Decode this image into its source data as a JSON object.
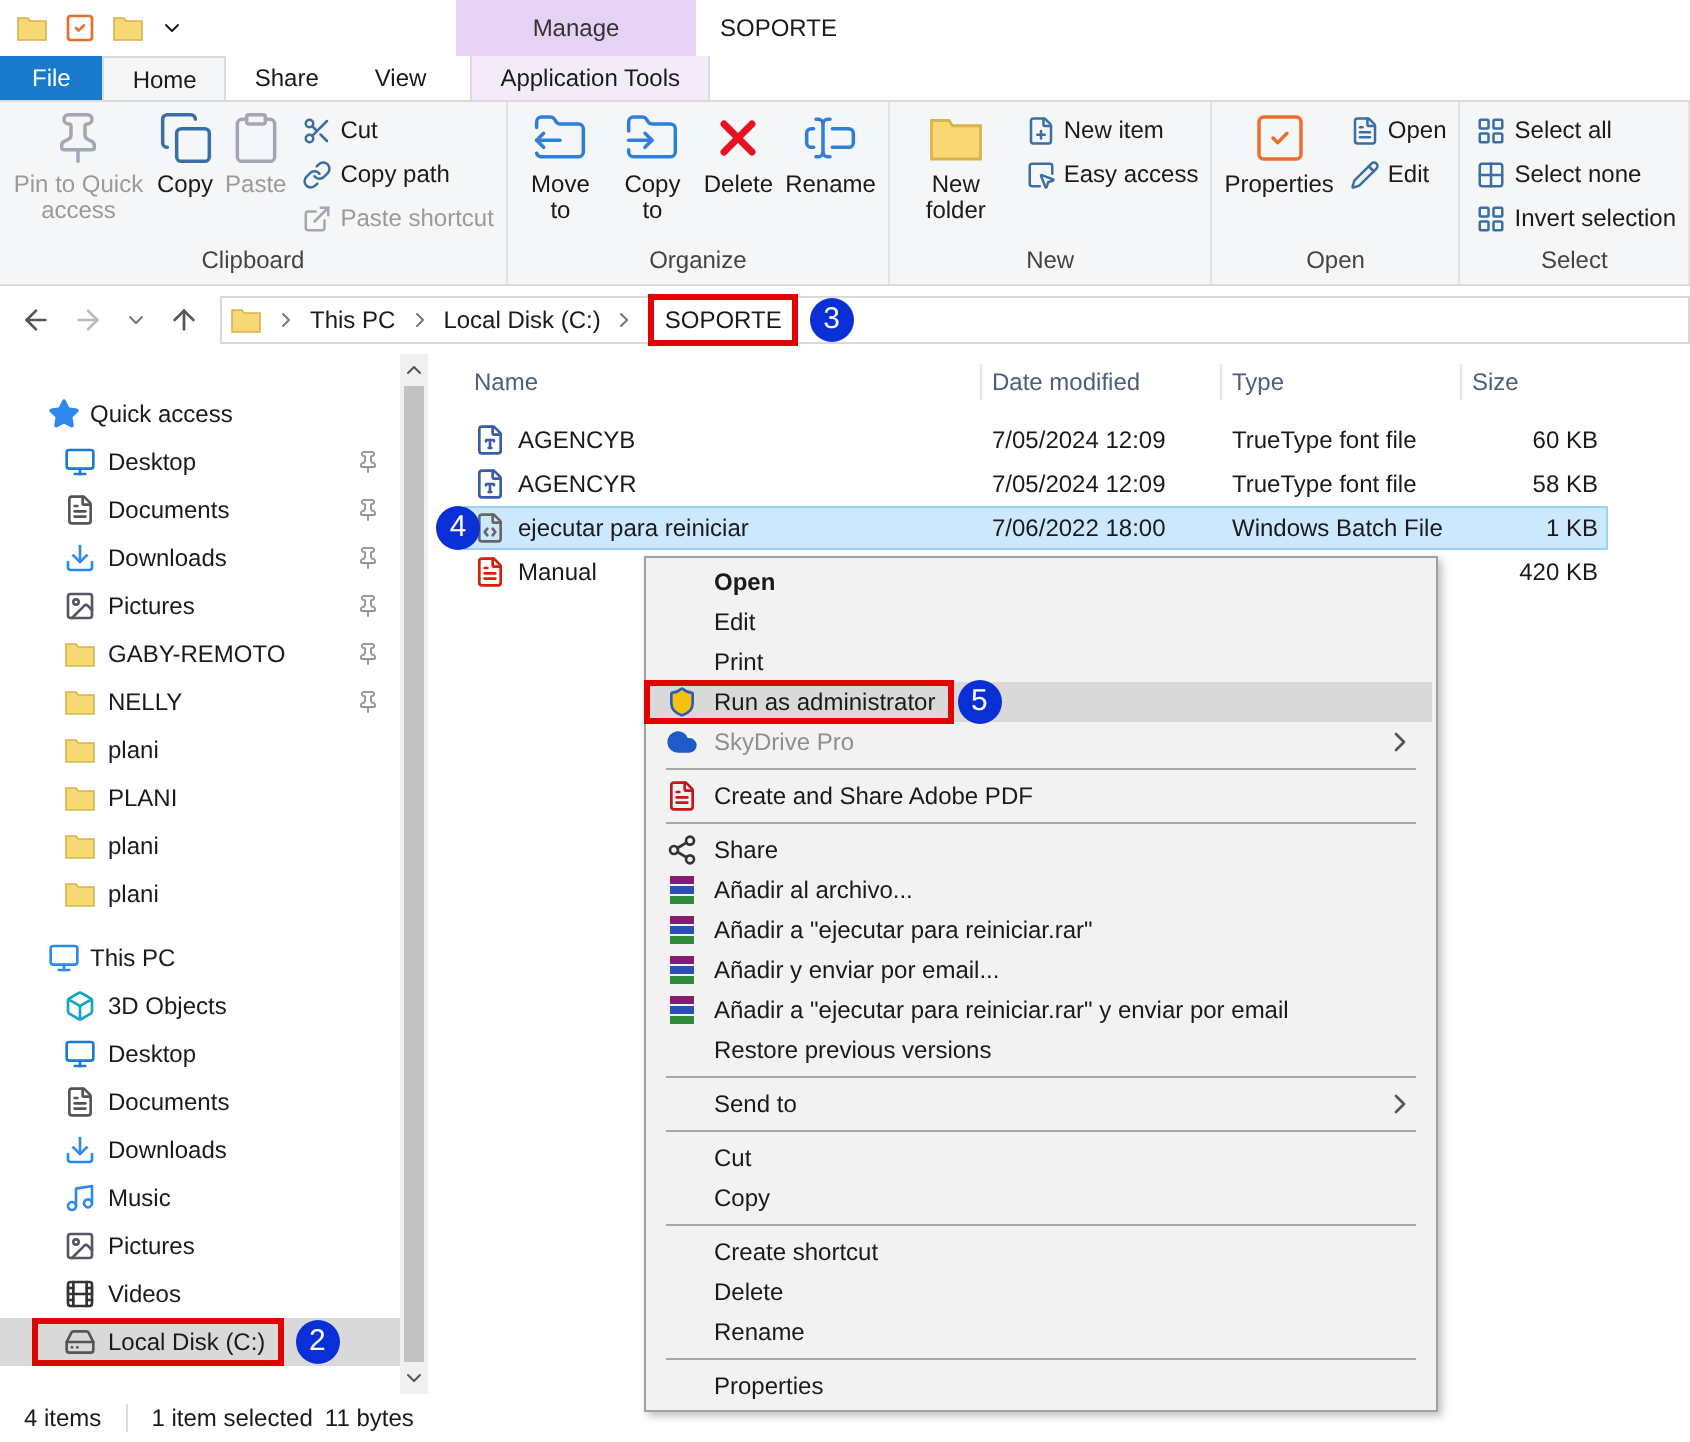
{
  "title_bar": {
    "context_tab": "Manage",
    "title": "SOPORTE"
  },
  "ribbon_tabs": [
    {
      "label": "File",
      "kind": "file",
      "selected": false
    },
    {
      "label": "Home",
      "kind": "tab",
      "selected": true
    },
    {
      "label": "Share",
      "kind": "tab",
      "selected": false
    },
    {
      "label": "View",
      "kind": "tab",
      "selected": false
    },
    {
      "label": "Application Tools",
      "kind": "context",
      "selected": false
    }
  ],
  "ribbon_groups": [
    {
      "label": "Clipboard",
      "buttons": [
        {
          "label": "Pin to Quick access",
          "kind": "large",
          "disabled": true
        },
        {
          "label": "Copy",
          "kind": "large",
          "disabled": false
        },
        {
          "label": "Paste",
          "kind": "large",
          "disabled": true
        },
        {
          "label": "Cut",
          "kind": "small",
          "disabled": false
        },
        {
          "label": "Copy path",
          "kind": "small",
          "disabled": false
        },
        {
          "label": "Paste shortcut",
          "kind": "small",
          "disabled": true
        }
      ]
    },
    {
      "label": "Organize",
      "buttons": [
        {
          "label": "Move to",
          "kind": "large",
          "disabled": false
        },
        {
          "label": "Copy to",
          "kind": "large",
          "disabled": false
        },
        {
          "label": "Delete",
          "kind": "large",
          "disabled": false
        },
        {
          "label": "Rename",
          "kind": "large",
          "disabled": false
        }
      ]
    },
    {
      "label": "New",
      "buttons": [
        {
          "label": "New folder",
          "kind": "large",
          "disabled": false
        },
        {
          "label": "New item",
          "kind": "small",
          "disabled": false
        },
        {
          "label": "Easy access",
          "kind": "small",
          "disabled": false
        }
      ]
    },
    {
      "label": "Open",
      "buttons": [
        {
          "label": "Properties",
          "kind": "large",
          "disabled": false
        },
        {
          "label": "Open",
          "kind": "small",
          "disabled": false
        },
        {
          "label": "Edit",
          "kind": "small",
          "disabled": false
        }
      ]
    },
    {
      "label": "Select",
      "buttons": [
        {
          "label": "Select all",
          "kind": "small",
          "disabled": false
        },
        {
          "label": "Select none",
          "kind": "small",
          "disabled": false
        },
        {
          "label": "Invert selection",
          "kind": "small",
          "disabled": false
        }
      ]
    }
  ],
  "address_bar": {
    "path": [
      {
        "label": "This PC"
      },
      {
        "label": "Local Disk (C:)"
      },
      {
        "label": "SOPORTE",
        "callout": "3"
      }
    ]
  },
  "nav_pane": [
    {
      "label": "Quick access",
      "kind": "star",
      "children": [
        {
          "label": "Desktop",
          "kind": "desktop",
          "pinned": true,
          "selected": false
        },
        {
          "label": "Documents",
          "kind": "documents",
          "pinned": true,
          "selected": false
        },
        {
          "label": "Downloads",
          "kind": "downloads",
          "pinned": true,
          "selected": false
        },
        {
          "label": "Pictures",
          "kind": "pictures",
          "pinned": true,
          "selected": false
        },
        {
          "label": "GABY-REMOTO",
          "kind": "folder",
          "pinned": true,
          "selected": false
        },
        {
          "label": "NELLY",
          "kind": "folder",
          "pinned": true,
          "selected": false
        },
        {
          "label": "plani",
          "kind": "folder",
          "pinned": false,
          "selected": false
        },
        {
          "label": "PLANI",
          "kind": "folder",
          "pinned": false,
          "selected": false
        },
        {
          "label": "plani",
          "kind": "folder",
          "pinned": false,
          "selected": false
        },
        {
          "label": "plani",
          "kind": "folder",
          "pinned": false,
          "selected": false
        }
      ]
    },
    {
      "label": "This PC",
      "kind": "pc",
      "children": [
        {
          "label": "3D Objects",
          "kind": "cube",
          "pinned": false,
          "selected": false
        },
        {
          "label": "Desktop",
          "kind": "desktop",
          "pinned": false,
          "selected": false
        },
        {
          "label": "Documents",
          "kind": "documents",
          "pinned": false,
          "selected": false
        },
        {
          "label": "Downloads",
          "kind": "downloads",
          "pinned": false,
          "selected": false
        },
        {
          "label": "Music",
          "kind": "music",
          "pinned": false,
          "selected": false
        },
        {
          "label": "Pictures",
          "kind": "pictures",
          "pinned": false,
          "selected": false
        },
        {
          "label": "Videos",
          "kind": "videos",
          "pinned": false,
          "selected": false
        },
        {
          "label": "Local Disk (C:)",
          "kind": "disk",
          "pinned": false,
          "selected": true,
          "callout": "2"
        }
      ]
    }
  ],
  "file_list": {
    "columns": [
      "Name",
      "Date modified",
      "Type",
      "Size"
    ],
    "rows": [
      {
        "kind": "font",
        "name": "AGENCYB",
        "date": "7/05/2024 12:09",
        "type": "TrueType font file",
        "size": "60 KB",
        "selected": false
      },
      {
        "kind": "font",
        "name": "AGENCYR",
        "date": "7/05/2024 12:09",
        "type": "TrueType font file",
        "size": "58 KB",
        "selected": false
      },
      {
        "kind": "batch",
        "name": "ejecutar para reiniciar",
        "date": "7/06/2022 18:00",
        "type": "Windows Batch File",
        "size": "1 KB",
        "selected": true,
        "callout": "4"
      },
      {
        "kind": "pdf",
        "name": "Manual",
        "size": "420 KB",
        "selected": false
      }
    ]
  },
  "context_menu": [
    {
      "kind": "item",
      "label": "Open",
      "bold": true
    },
    {
      "kind": "item",
      "label": "Edit"
    },
    {
      "kind": "item",
      "label": "Print"
    },
    {
      "kind": "admin",
      "label": "Run as administrator",
      "highlighted": true,
      "callout": "5"
    },
    {
      "kind": "cloud",
      "label": "SkyDrive Pro",
      "disabled": true,
      "submenu": true
    },
    {
      "kind": "separator"
    },
    {
      "kind": "pdf",
      "label": "Create and Share Adobe PDF"
    },
    {
      "kind": "separator"
    },
    {
      "kind": "share",
      "label": "Share"
    },
    {
      "kind": "archive",
      "label": "Añadir al archivo..."
    },
    {
      "kind": "archive",
      "label": "Añadir a \"ejecutar para reiniciar.rar\""
    },
    {
      "kind": "archive",
      "label": "Añadir y enviar por email..."
    },
    {
      "kind": "archive",
      "label": "Añadir a \"ejecutar para reiniciar.rar\" y enviar por email"
    },
    {
      "kind": "item",
      "label": "Restore previous versions"
    },
    {
      "kind": "separator"
    },
    {
      "kind": "item",
      "label": "Send to",
      "submenu": true
    },
    {
      "kind": "separator"
    },
    {
      "kind": "item",
      "label": "Cut"
    },
    {
      "kind": "item",
      "label": "Copy"
    },
    {
      "kind": "separator"
    },
    {
      "kind": "item",
      "label": "Create shortcut"
    },
    {
      "kind": "item",
      "label": "Delete"
    },
    {
      "kind": "item",
      "label": "Rename"
    },
    {
      "kind": "separator"
    },
    {
      "kind": "item",
      "label": "Properties"
    }
  ],
  "status_bar": {
    "item_count": "4 items",
    "selection": "1 item selected",
    "selection_size": "11 bytes"
  }
}
